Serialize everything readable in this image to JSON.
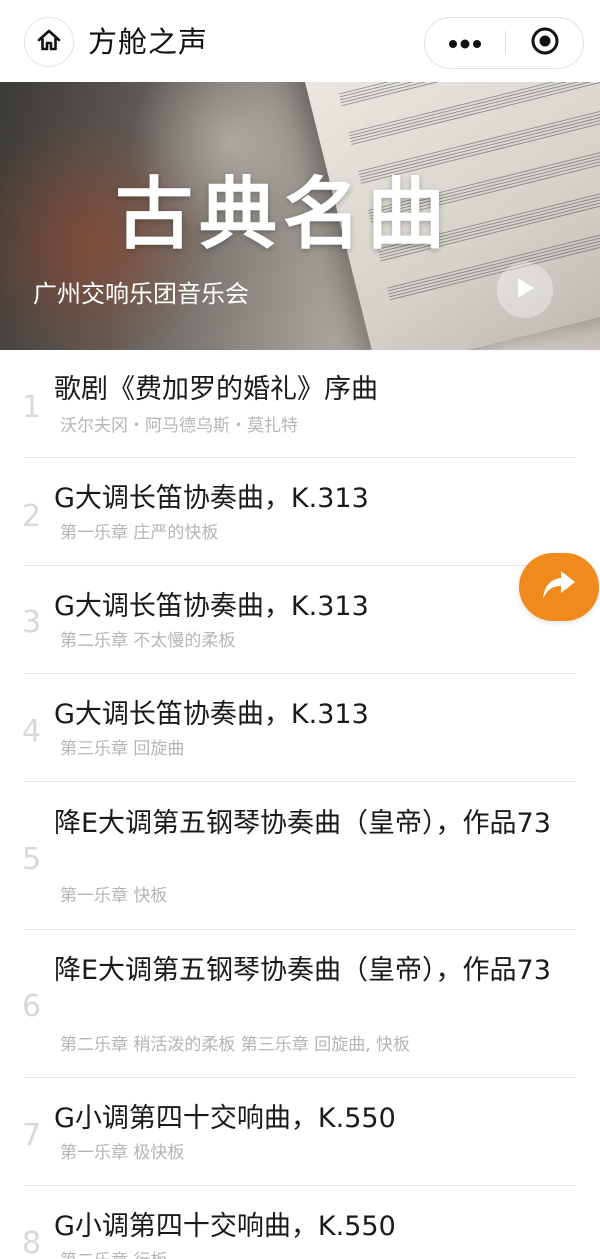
{
  "navbar": {
    "title": "方舱之声",
    "home_icon": "home-icon",
    "more_icon": "more-dots-icon",
    "close_icon": "target-close-icon"
  },
  "banner": {
    "title": "古典名曲",
    "subtitle": "广州交响乐团音乐会",
    "play_icon": "play-icon"
  },
  "tracks": [
    {
      "num": "1",
      "title": "歌剧《费加罗的婚礼》序曲",
      "sub": "沃尔夫冈・阿马德乌斯・莫扎特"
    },
    {
      "num": "2",
      "title": "G大调长笛协奏曲，K.313",
      "sub": "第一乐章 庄严的快板"
    },
    {
      "num": "3",
      "title": "G大调长笛协奏曲，K.313",
      "sub": "第二乐章 不太慢的柔板"
    },
    {
      "num": "4",
      "title": "G大调长笛协奏曲，K.313",
      "sub": "第三乐章 回旋曲"
    },
    {
      "num": "5",
      "title": "降E大调第五钢琴协奏曲（皇帝），作品73",
      "sub": "第一乐章 快板"
    },
    {
      "num": "6",
      "title": "降E大调第五钢琴协奏曲（皇帝），作品73",
      "sub": "第二乐章 稍活泼的柔板 第三乐章 回旋曲, 快板"
    },
    {
      "num": "7",
      "title": "G小调第四十交响曲，K.550",
      "sub": "第一乐章 极快板"
    },
    {
      "num": "8",
      "title": "G小调第四十交响曲，K.550",
      "sub": "第二乐章 行板"
    }
  ],
  "share_fab": {
    "icon": "share-arrow-icon"
  },
  "colors": {
    "accent": "#f08a1c",
    "number": "#d8d8d8",
    "subtext": "#b5b5b5"
  }
}
